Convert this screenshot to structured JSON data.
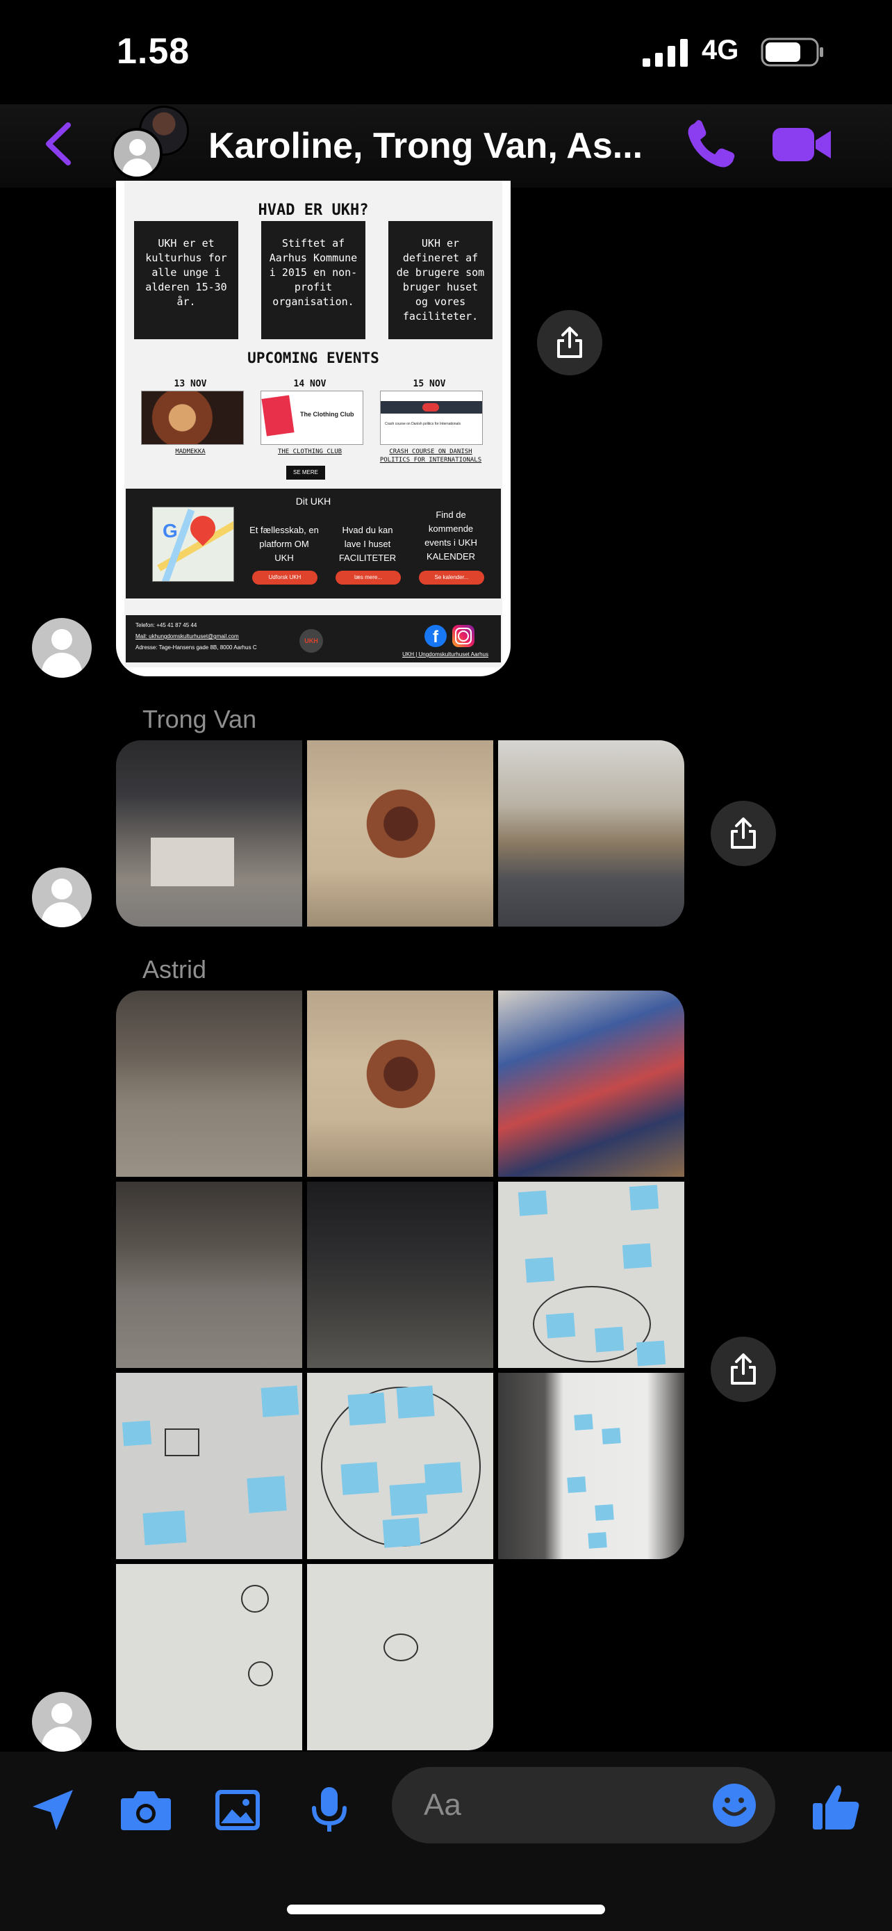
{
  "status_bar": {
    "time": "1.58",
    "network": "4G"
  },
  "header": {
    "title": "Karoline, Trong Van, As...",
    "accent_color": "#8b3df0"
  },
  "flyer": {
    "heading": "HVAD ER UKH?",
    "boxes": [
      "UKH er et kulturhus for alle unge i alderen 15-30 år.",
      "Stiftet af Aarhus Kommune i 2015 en non-profit organisation.",
      "UKH er defineret af de brugere som bruger huset og vores faciliteter."
    ],
    "events_heading": "UPCOMING EVENTS",
    "events": [
      {
        "date": "13 NOV",
        "caption": "MADMEKKA"
      },
      {
        "date": "14 NOV",
        "caption": "THE CLOTHING CLUB",
        "image_text": "The Clothing Club"
      },
      {
        "date": "15 NOV",
        "caption": "CRASH COURSE ON DANISH POLITICS FOR INTERNATIONALS",
        "image_text": "Crash course on Danish politics for Internationals"
      }
    ],
    "see_more": "SE MERE",
    "dit_ukh": "Dit UKH",
    "columns": [
      {
        "text": "Et fællesskab, en platform OM UKH",
        "button": "Udforsk UKH"
      },
      {
        "text": "Hvad du kan lave I huset FACILITETER",
        "button": "læs mere..."
      },
      {
        "text": "Find de kommende events i UKH KALENDER",
        "button": "Se kalender..."
      }
    ],
    "footer": {
      "phone": "Telefon: +45 41 87 45 44",
      "mail": "Mail: ukhungdomskulturhuset@gmail.com",
      "address": "Adresse: Tage-Hansens gade 8B, 8000 Aarhus C",
      "logo": "UKH",
      "brand": "UKH | Ungdomskulturhuset Aarhus"
    }
  },
  "senders": {
    "trong_van": "Trong Van",
    "astrid": "Astrid"
  },
  "icons": {
    "back": "chevron-left-icon",
    "call": "phone-icon",
    "video": "video-camera-icon",
    "share": "share-icon",
    "location": "location-arrow-icon",
    "camera": "camera-icon",
    "gallery": "image-icon",
    "mic": "microphone-icon",
    "emoji": "smiley-icon",
    "like": "thumbs-up-icon"
  },
  "composer": {
    "placeholder": "Aa",
    "icon_color": "#3b82f6"
  }
}
